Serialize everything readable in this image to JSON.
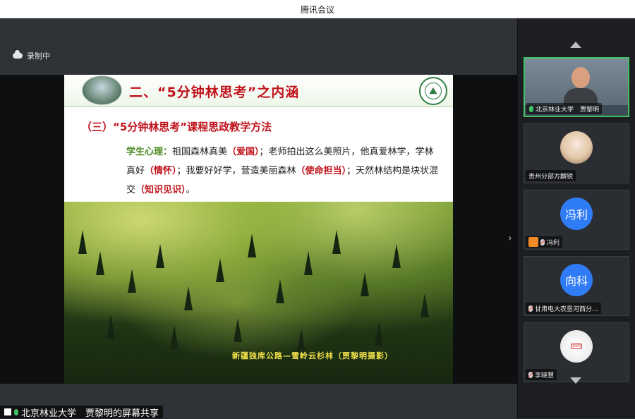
{
  "window": {
    "title": "腾讯会议"
  },
  "recording": {
    "label": "录制中"
  },
  "slide": {
    "title": "二、“5分钟林思考”之内涵",
    "subtitle": "（三）“5分钟林思考”课程思政教学方法",
    "paragraph": [
      {
        "text": "学生心理：",
        "style": "green"
      },
      {
        "text": "祖国森林真美",
        "style": "normal"
      },
      {
        "text": "（爱国）",
        "style": "red"
      },
      {
        "text": "；老师拍出这么美照片，他真爱林学，学林真好",
        "style": "normal"
      },
      {
        "text": "（情怀）",
        "style": "red"
      },
      {
        "text": "；我要好好学，营造美丽森林",
        "style": "normal"
      },
      {
        "text": "（使命担当）",
        "style": "red"
      },
      {
        "text": "；天然林结构是块状混交",
        "style": "normal"
      },
      {
        "text": "（知识见识）",
        "style": "red"
      },
      {
        "text": "。",
        "style": "normal"
      }
    ],
    "photo_caption": "新疆独库公路—雪岭云杉林（贾黎明摄影）"
  },
  "participants": [
    {
      "name": "北京林业大学　贾黎明",
      "type": "video",
      "mic": "on"
    },
    {
      "name": "贵州分部方麟锐",
      "type": "avatar-image",
      "mic": "none"
    },
    {
      "name": "冯利",
      "avatar_text": "冯利",
      "type": "avatar-text",
      "mic": "muted"
    },
    {
      "name": "甘肃电大农垦河西分...",
      "avatar_text": "向科",
      "type": "avatar-text",
      "mic": "muted"
    },
    {
      "name": "李晓慧",
      "type": "avatar-image",
      "mic": "muted"
    }
  ],
  "share_banner": {
    "text": "北京林业大学　贾黎明的屏幕共享"
  },
  "colors": {
    "accent_red": "#c0121b",
    "accent_green": "#4d8b21",
    "active_border": "#41c163",
    "avatar_blue": "#2f7cf6"
  }
}
